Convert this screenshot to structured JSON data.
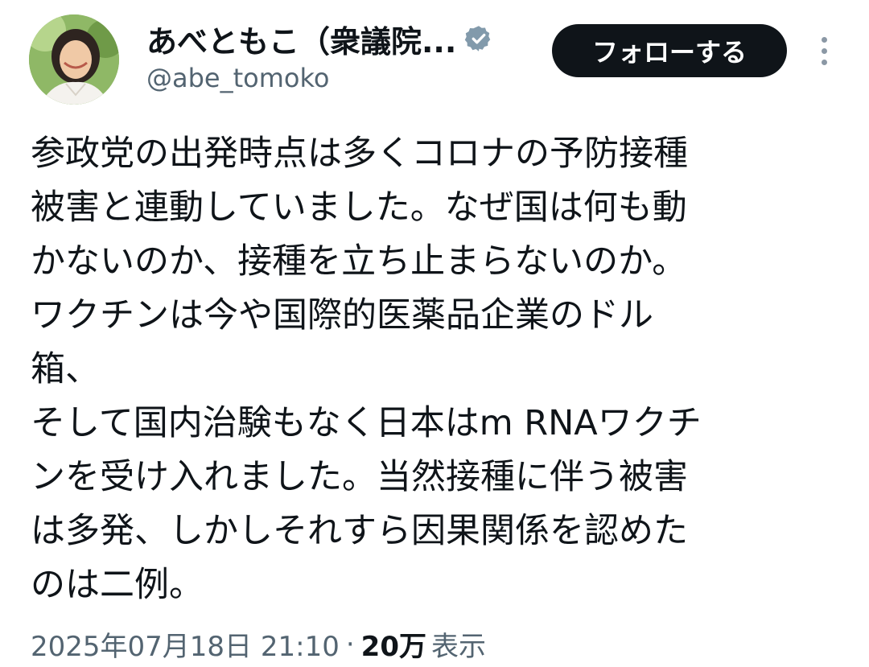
{
  "user": {
    "display_name": "あべともこ（衆議院...",
    "handle": "@abe_tomoko",
    "verified_icon": "verified-badge-icon",
    "avatar": "avatar-photo"
  },
  "actions": {
    "follow_label": "フォローする",
    "more_icon": "more-vertical-icon"
  },
  "tweet": {
    "lines": [
      "参政党の出発時点は多くコロナの予防接種",
      "被害と連動していました。なぜ国は何も動",
      "かないのか、接種を立ち止まらないのか。",
      "ワクチンは今や国際的医薬品企業のドル",
      "箱、",
      "そして国内治験もなく日本はm RNAワクチ",
      "ンを受け入れました。当然接種に伴う被害",
      "は多発、しかしそれすら因果関係を認めた",
      "のは二例。"
    ]
  },
  "meta": {
    "timestamp": "2025年07月18日 21:10",
    "separator": "·",
    "views_count": "20万",
    "views_label": "表示"
  },
  "colors": {
    "text_primary": "#0f1419",
    "text_secondary": "#536471",
    "button_bg": "#0f1419",
    "button_text": "#ffffff",
    "verified": "#829aab"
  }
}
